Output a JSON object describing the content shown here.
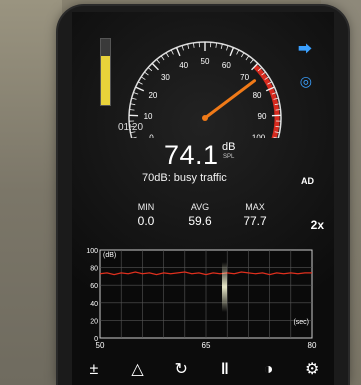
{
  "meter": {
    "elapsed": "01:20",
    "reading": "74.1",
    "unit": "dB",
    "unit_sub": "SPL",
    "description": "70dB: busy traffic",
    "ad_label": "AD",
    "level_fraction": 0.74,
    "gauge_value": 74.1,
    "gauge_ticks": [
      "0",
      "10",
      "20",
      "30",
      "40",
      "50",
      "60",
      "70",
      "80",
      "90",
      "100"
    ]
  },
  "stats": {
    "min_label": "MIN",
    "min_value": "0.0",
    "avg_label": "AVG",
    "avg_value": "59.6",
    "max_label": "MAX",
    "max_value": "77.7"
  },
  "zoom_label": "2x",
  "side_icons": [
    "share-icon",
    "compass-icon"
  ],
  "chart_data": {
    "type": "line",
    "ylabel": "(dB)",
    "xlabel": "(sec)",
    "ylim": [
      0,
      100
    ],
    "xlim": [
      50,
      80
    ],
    "y_ticks": [
      "100",
      "80",
      "60",
      "40",
      "20",
      "0"
    ],
    "x_ticks": [
      "50",
      "65",
      "80"
    ],
    "series": [
      {
        "color": "#e0301e",
        "x": [
          50,
          51,
          52,
          53,
          54,
          55,
          56,
          57,
          58,
          59,
          60,
          61,
          62,
          63,
          64,
          65,
          66,
          67,
          68,
          69,
          70,
          71,
          72,
          73,
          74,
          75,
          76,
          77,
          78,
          79,
          80
        ],
        "values": [
          73,
          74,
          72,
          74,
          73,
          75,
          73,
          74,
          72,
          74,
          73,
          74,
          75,
          73,
          74,
          72,
          74,
          73,
          74,
          73,
          75,
          74,
          73,
          74,
          72,
          74,
          73,
          74,
          73,
          74,
          74
        ]
      }
    ]
  },
  "toolbar": [
    "plus-minus-icon",
    "warning-icon",
    "reset-icon",
    "pause-icon",
    "theme-icon",
    "settings-icon"
  ],
  "colors": {
    "accent": "#3aa0ff",
    "needle": "#f07a18",
    "level": "#e8d23a",
    "redzone": "#d62a1e"
  }
}
